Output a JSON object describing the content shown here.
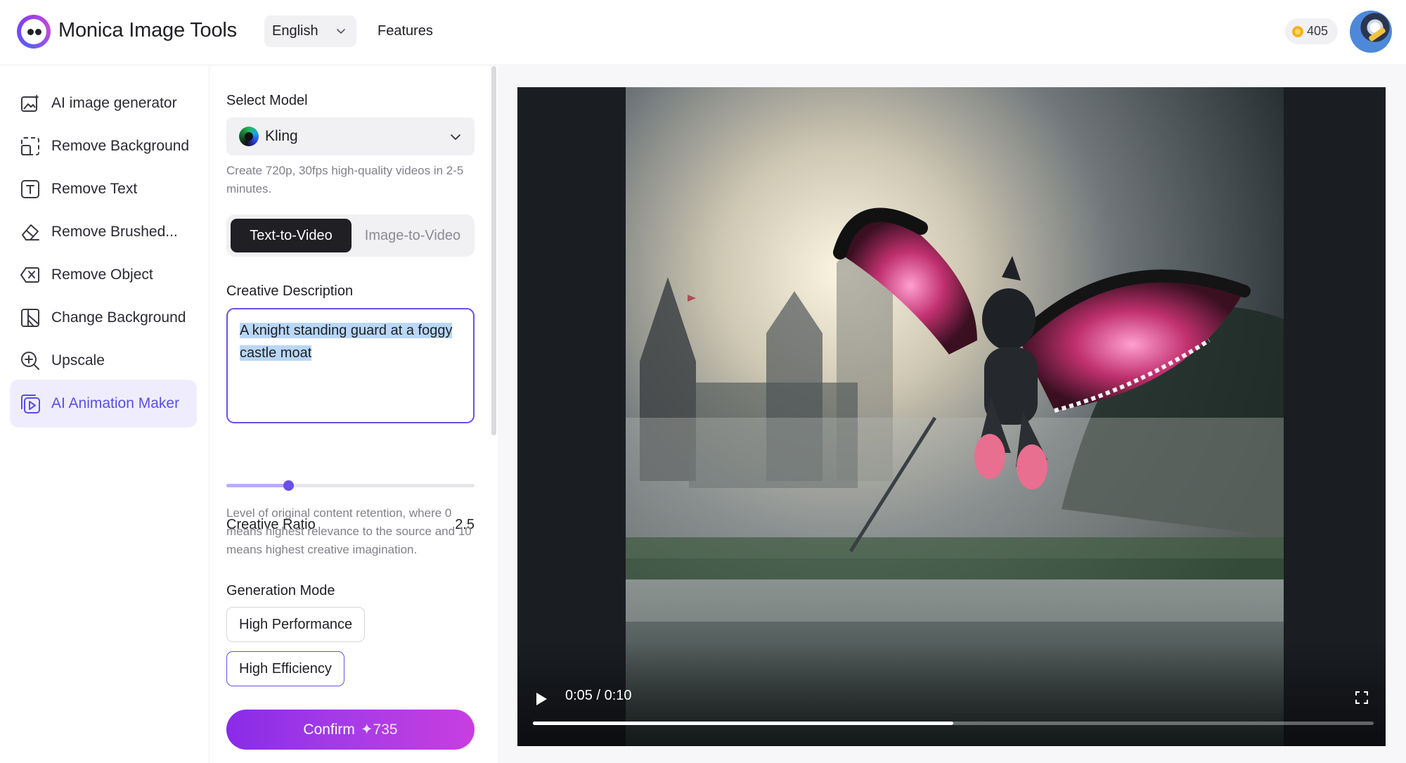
{
  "header": {
    "brand_name": "Monica",
    "brand_product": "Image Tools",
    "language": "English",
    "features_label": "Features",
    "credits": "405"
  },
  "sidebar": {
    "items": [
      {
        "label": "AI image generator",
        "icon": "ai-image-icon"
      },
      {
        "label": "Remove Background",
        "icon": "remove-background-icon"
      },
      {
        "label": "Remove Text",
        "icon": "text-icon"
      },
      {
        "label": "Remove Brushed...",
        "icon": "eraser-icon"
      },
      {
        "label": "Remove Object",
        "icon": "remove-object-icon"
      },
      {
        "label": "Change Background",
        "icon": "change-background-icon"
      },
      {
        "label": "Upscale",
        "icon": "upscale-icon"
      },
      {
        "label": "AI Animation Maker",
        "icon": "animation-icon",
        "active": true
      }
    ]
  },
  "panel": {
    "select_model_title": "Select Model",
    "model": "Kling",
    "model_hint": "Create 720p, 30fps high-quality videos in 2-5 minutes.",
    "tabs": {
      "active": "Text-to-Video",
      "inactive": "Image-to-Video"
    },
    "creative_description_title": "Creative Description",
    "creative_description": "A knight standing guard at a foggy castle moat",
    "creative_ratio_title": "Creative Ratio",
    "creative_ratio_value": "2.5",
    "creative_ratio_fraction": 0.25,
    "creative_ratio_hint": "Level of original content retention, where 0 means highest relevance to the source and 10 means highest creative imagination.",
    "generation_mode_title": "Generation Mode",
    "modes": [
      "High Performance",
      "High Efficiency"
    ],
    "selected_mode": "High Efficiency",
    "confirm_label": "Confirm",
    "confirm_cost": "735"
  },
  "video": {
    "time": "0:05 / 0:10",
    "progress_fraction": 0.5
  },
  "colors": {
    "accent": "#6a4fe8",
    "active_nav_bg": "#efedfd",
    "confirm_gradient_start": "#8a2be8",
    "confirm_gradient_end": "#c83ee0",
    "coin": "#f4b21a"
  }
}
